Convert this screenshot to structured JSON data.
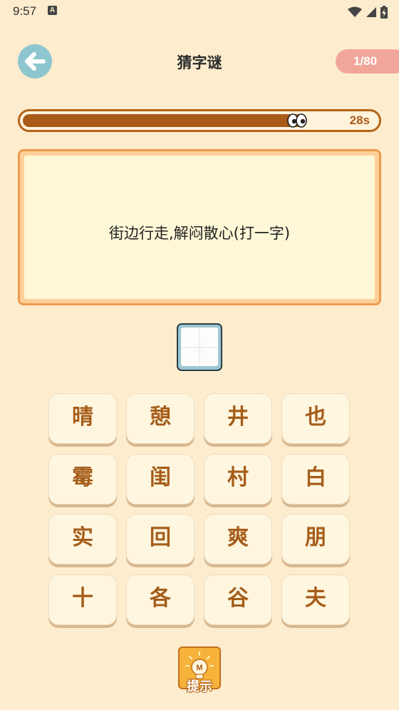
{
  "status_bar": {
    "time": "9:57",
    "notification_letter": "A",
    "icons": [
      "wifi-icon",
      "signal-icon",
      "battery-charging-icon"
    ]
  },
  "header": {
    "back_icon": "arrow-left-icon",
    "title": "猜字谜",
    "level": "1/80"
  },
  "timer": {
    "remaining": "28s",
    "progress": 0.8,
    "fill_color": "#a85a18",
    "icon": "eyes-icon"
  },
  "riddle": {
    "text": "街边行走,解闷散心(打一字)"
  },
  "answer": {
    "value": ""
  },
  "keys": [
    "晴",
    "憩",
    "井",
    "也",
    "霉",
    "闺",
    "村",
    "白",
    "实",
    "回",
    "爽",
    "朋",
    "十",
    "各",
    "谷",
    "夫"
  ],
  "hint": {
    "label": "提示",
    "icon": "lightbulb-icon",
    "badge": "M"
  },
  "colors": {
    "background": "#fdeccd",
    "accent_brown": "#a55d1a",
    "badge_pink": "#f2a69a",
    "back_button_blue": "#8ec6cf"
  }
}
